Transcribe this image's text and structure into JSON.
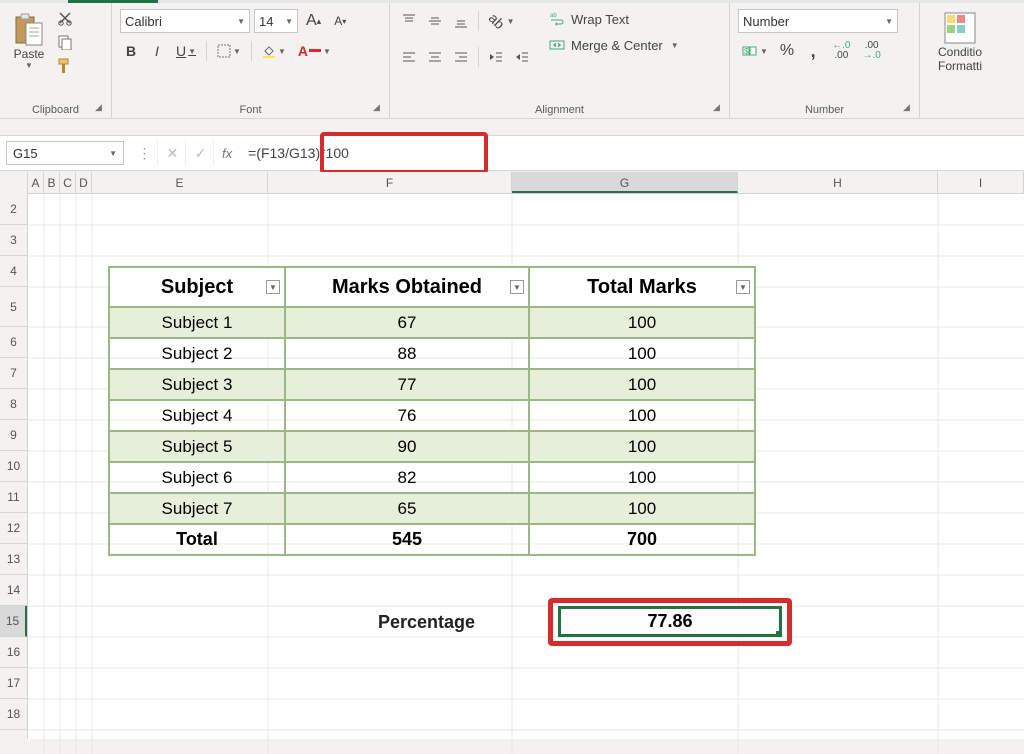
{
  "ribbon": {
    "clipboard": {
      "label": "Clipboard",
      "paste": "Paste"
    },
    "font": {
      "label": "Font",
      "name": "Calibri",
      "size": "14",
      "increase": "A",
      "decrease": "A",
      "bold": "B",
      "italic": "I",
      "underline": "U"
    },
    "alignment": {
      "label": "Alignment",
      "wrap": "Wrap Text",
      "merge": "Merge & Center"
    },
    "number": {
      "label": "Number",
      "format": "Number",
      "percent": "%",
      "comma": ",",
      "inc": ".0",
      "inc2": ".00",
      "dec": ".00",
      "dec2": ".0"
    },
    "styles": {
      "cond1": "Conditio",
      "cond2": "Formatti"
    }
  },
  "formula_bar": {
    "name_box": "G15",
    "fx": "fx",
    "formula": "=(F13/G13)*100"
  },
  "columns": [
    "A",
    "B",
    "C",
    "D",
    "E",
    "F",
    "G",
    "H",
    "I"
  ],
  "rows": [
    "2",
    "3",
    "4",
    "5",
    "6",
    "7",
    "8",
    "9",
    "10",
    "11",
    "12",
    "13",
    "14",
    "15",
    "16",
    "17",
    "18"
  ],
  "table": {
    "headers": [
      "Subject",
      "Marks Obtained",
      "Total Marks"
    ],
    "rows": [
      {
        "s": "Subject 1",
        "m": "67",
        "t": "100"
      },
      {
        "s": "Subject 2",
        "m": "88",
        "t": "100"
      },
      {
        "s": "Subject 3",
        "m": "77",
        "t": "100"
      },
      {
        "s": "Subject 4",
        "m": "76",
        "t": "100"
      },
      {
        "s": "Subject 5",
        "m": "90",
        "t": "100"
      },
      {
        "s": "Subject 6",
        "m": "82",
        "t": "100"
      },
      {
        "s": "Subject 7",
        "m": "65",
        "t": "100"
      }
    ],
    "total": {
      "label": "Total",
      "m": "545",
      "t": "700"
    }
  },
  "percentage": {
    "label": "Percentage",
    "value": "77.86"
  }
}
